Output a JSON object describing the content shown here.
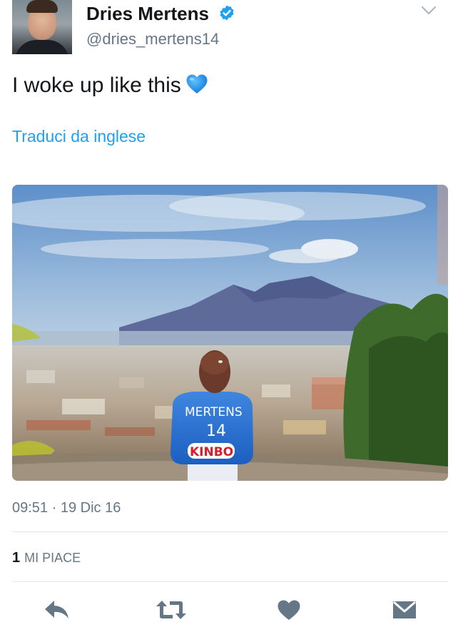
{
  "author": {
    "name": "Dries Mertens",
    "handle": "@dries_mertens14",
    "verified": true,
    "avatar_icon": "profile-photo"
  },
  "tweet": {
    "text": "I woke up like this",
    "emoji": "blue-heart",
    "translate_link": "Traduci da inglese",
    "image_shirt_lines": [
      "MERTENS",
      "14",
      "KINBO"
    ]
  },
  "meta": {
    "time": "09:51",
    "separator": "·",
    "date": "19 Dic 16"
  },
  "stats": {
    "likes_count": "1",
    "likes_label": "MI PIACE"
  },
  "actions": [
    {
      "icon": "reply-icon"
    },
    {
      "icon": "retweet-icon"
    },
    {
      "icon": "like-heart-icon"
    },
    {
      "icon": "direct-message-icon"
    }
  ],
  "colors": {
    "link": "#1da1f2",
    "secondary_text": "#657786",
    "action_icon": "#657786",
    "verified_badge": "#1da1f2",
    "emoji_heart": "#1e9be9"
  }
}
